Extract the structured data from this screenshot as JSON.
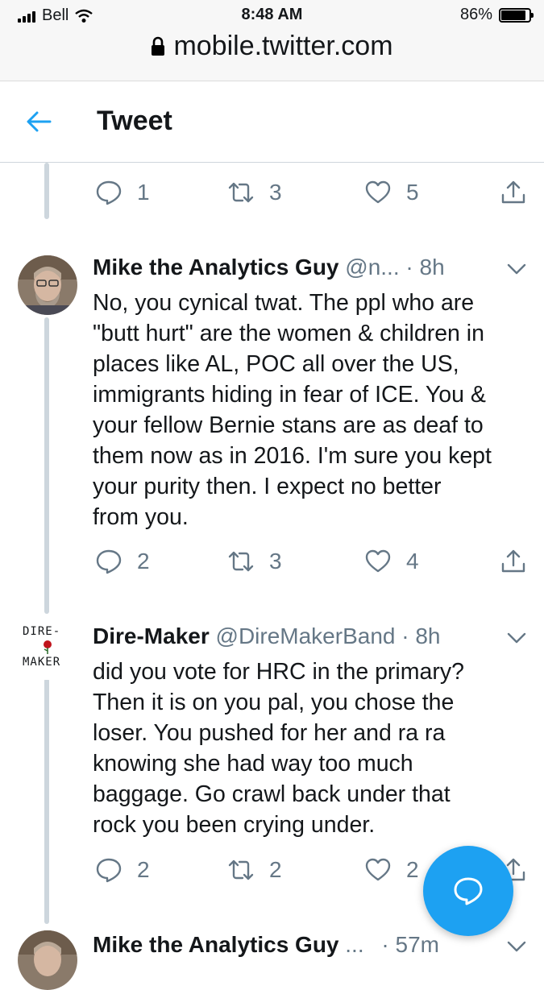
{
  "status_bar": {
    "carrier": "Bell",
    "time": "8:48 AM",
    "battery": "86%"
  },
  "url_bar": {
    "url": "mobile.twitter.com"
  },
  "header": {
    "title": "Tweet"
  },
  "top_actions": {
    "replies": "1",
    "retweets": "3",
    "likes": "5"
  },
  "tweets": [
    {
      "name": "Mike the Analytics Guy",
      "handle": "@n...",
      "time": "· 8h",
      "text": [
        "No, you cynical twat. The ppl who are",
        "\"butt hurt\" are the women & children in",
        "places like AL, POC all over the US,",
        "immigrants hiding in fear of ICE. You &",
        "your fellow Bernie stans are as deaf to",
        "them now as in 2016. I'm sure you kept",
        "your purity then. I expect no better",
        "from you."
      ],
      "replies": "2",
      "retweets": "3",
      "likes": "4"
    },
    {
      "name": "Dire-Maker",
      "handle": "@DireMakerBand",
      "time": "· 8h",
      "avatar_text_top": "DIRE-",
      "avatar_text_bottom": "MAKER",
      "text": [
        "did you vote for HRC in the primary?",
        "Then it is on you pal, you chose the",
        "loser.  You pushed for her and ra ra",
        "knowing she had way too much",
        "baggage.  Go crawl back under that",
        "rock you been crying under."
      ],
      "replies": "2",
      "retweets": "2",
      "likes": "2"
    },
    {
      "name": "Mike the Analytics Guy",
      "handle": "...",
      "time": "· 57m"
    }
  ],
  "icons": {
    "back": "arrow-left-icon",
    "reply": "comment-icon",
    "retweet": "retweet-icon",
    "like": "heart-icon",
    "share": "share-icon",
    "compose": "compose-reply-icon",
    "more": "chevron-down-icon"
  },
  "colors": {
    "accent": "#1da1f2",
    "secondary_text": "#657786",
    "thread_line": "#cdd6dd"
  }
}
